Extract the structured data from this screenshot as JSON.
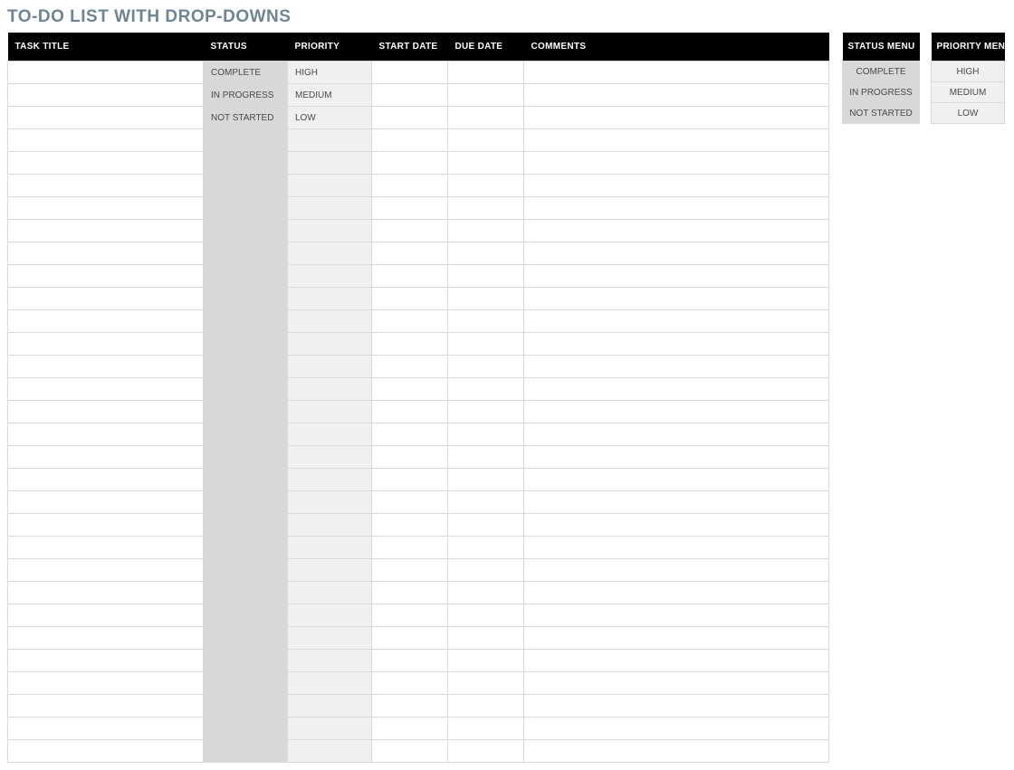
{
  "title": "TO-DO LIST WITH DROP-DOWNS",
  "columns": {
    "task_title": "TASK TITLE",
    "status": "STATUS",
    "priority": "PRIORITY",
    "start_date": "START DATE",
    "due_date": "DUE DATE",
    "comments": "COMMENTS"
  },
  "rows": [
    {
      "task_title": "",
      "status": "COMPLETE",
      "priority": "HIGH",
      "start_date": "",
      "due_date": "",
      "comments": ""
    },
    {
      "task_title": "",
      "status": "IN PROGRESS",
      "priority": "MEDIUM",
      "start_date": "",
      "due_date": "",
      "comments": ""
    },
    {
      "task_title": "",
      "status": "NOT STARTED",
      "priority": "LOW",
      "start_date": "",
      "due_date": "",
      "comments": ""
    },
    {
      "task_title": "",
      "status": "",
      "priority": "",
      "start_date": "",
      "due_date": "",
      "comments": ""
    },
    {
      "task_title": "",
      "status": "",
      "priority": "",
      "start_date": "",
      "due_date": "",
      "comments": ""
    },
    {
      "task_title": "",
      "status": "",
      "priority": "",
      "start_date": "",
      "due_date": "",
      "comments": ""
    },
    {
      "task_title": "",
      "status": "",
      "priority": "",
      "start_date": "",
      "due_date": "",
      "comments": ""
    },
    {
      "task_title": "",
      "status": "",
      "priority": "",
      "start_date": "",
      "due_date": "",
      "comments": ""
    },
    {
      "task_title": "",
      "status": "",
      "priority": "",
      "start_date": "",
      "due_date": "",
      "comments": ""
    },
    {
      "task_title": "",
      "status": "",
      "priority": "",
      "start_date": "",
      "due_date": "",
      "comments": ""
    },
    {
      "task_title": "",
      "status": "",
      "priority": "",
      "start_date": "",
      "due_date": "",
      "comments": ""
    },
    {
      "task_title": "",
      "status": "",
      "priority": "",
      "start_date": "",
      "due_date": "",
      "comments": ""
    },
    {
      "task_title": "",
      "status": "",
      "priority": "",
      "start_date": "",
      "due_date": "",
      "comments": ""
    },
    {
      "task_title": "",
      "status": "",
      "priority": "",
      "start_date": "",
      "due_date": "",
      "comments": ""
    },
    {
      "task_title": "",
      "status": "",
      "priority": "",
      "start_date": "",
      "due_date": "",
      "comments": ""
    },
    {
      "task_title": "",
      "status": "",
      "priority": "",
      "start_date": "",
      "due_date": "",
      "comments": ""
    },
    {
      "task_title": "",
      "status": "",
      "priority": "",
      "start_date": "",
      "due_date": "",
      "comments": ""
    },
    {
      "task_title": "",
      "status": "",
      "priority": "",
      "start_date": "",
      "due_date": "",
      "comments": ""
    },
    {
      "task_title": "",
      "status": "",
      "priority": "",
      "start_date": "",
      "due_date": "",
      "comments": ""
    },
    {
      "task_title": "",
      "status": "",
      "priority": "",
      "start_date": "",
      "due_date": "",
      "comments": ""
    },
    {
      "task_title": "",
      "status": "",
      "priority": "",
      "start_date": "",
      "due_date": "",
      "comments": ""
    },
    {
      "task_title": "",
      "status": "",
      "priority": "",
      "start_date": "",
      "due_date": "",
      "comments": ""
    },
    {
      "task_title": "",
      "status": "",
      "priority": "",
      "start_date": "",
      "due_date": "",
      "comments": ""
    },
    {
      "task_title": "",
      "status": "",
      "priority": "",
      "start_date": "",
      "due_date": "",
      "comments": ""
    },
    {
      "task_title": "",
      "status": "",
      "priority": "",
      "start_date": "",
      "due_date": "",
      "comments": ""
    },
    {
      "task_title": "",
      "status": "",
      "priority": "",
      "start_date": "",
      "due_date": "",
      "comments": ""
    },
    {
      "task_title": "",
      "status": "",
      "priority": "",
      "start_date": "",
      "due_date": "",
      "comments": ""
    },
    {
      "task_title": "",
      "status": "",
      "priority": "",
      "start_date": "",
      "due_date": "",
      "comments": ""
    },
    {
      "task_title": "",
      "status": "",
      "priority": "",
      "start_date": "",
      "due_date": "",
      "comments": ""
    },
    {
      "task_title": "",
      "status": "",
      "priority": "",
      "start_date": "",
      "due_date": "",
      "comments": ""
    },
    {
      "task_title": "",
      "status": "",
      "priority": "",
      "start_date": "",
      "due_date": "",
      "comments": ""
    }
  ],
  "status_menu": {
    "header": "STATUS MENU",
    "items": [
      "COMPLETE",
      "IN PROGRESS",
      "NOT STARTED"
    ]
  },
  "priority_menu": {
    "header": "PRIORITY MENU",
    "items": [
      "HIGH",
      "MEDIUM",
      "LOW"
    ]
  }
}
